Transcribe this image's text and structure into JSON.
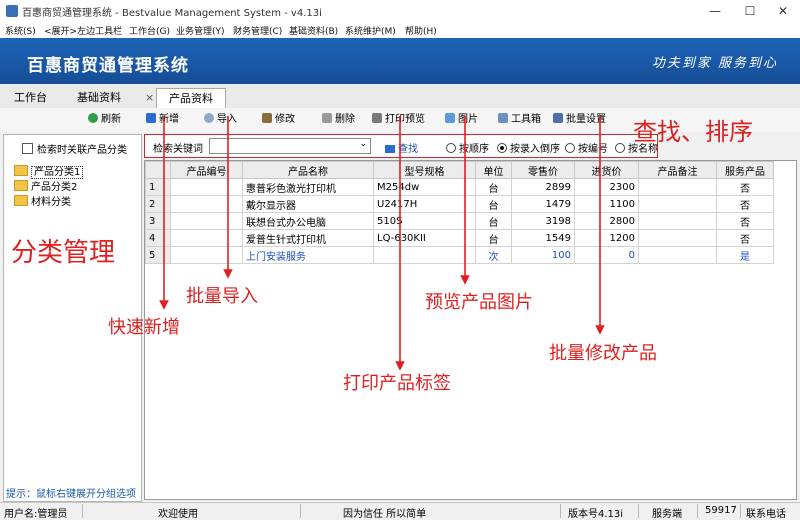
{
  "window": {
    "title": "百惠商贸通管理系统 - Bestvalue Management System - v4.13i",
    "minimize": "—",
    "maximize": "☐",
    "close": "✕"
  },
  "menu": [
    "系统(S)",
    "<展开>左边工具栏",
    "工作台(G)",
    "业务管理(Y)",
    "财务管理(C)",
    "基础资料(B)",
    "系统维护(M)",
    "帮助(H)"
  ],
  "banner": {
    "title": "百惠商贸通管理系统",
    "slogan": "功夫到家  服务到心"
  },
  "tabs": [
    {
      "label": "工作台"
    },
    {
      "label": "基础资料"
    },
    {
      "label": "产品资料",
      "close": "×"
    }
  ],
  "toolbar": {
    "refresh": "刷新",
    "add": "新增",
    "import": "导入",
    "modify": "修改",
    "delete": "删除",
    "print_preview": "打印预览",
    "image": "图片",
    "toolbox": "工具箱",
    "batch_settings": "批量设置"
  },
  "left_panel": {
    "checkbox_label": "检索时关联产品分类",
    "tree": [
      "产品分类1",
      "产品分类2",
      "材料分类"
    ],
    "hint": "提示：鼠标右键展开分组选项"
  },
  "search": {
    "keyword_label": "检索关键词",
    "value": "",
    "find_button": "查找",
    "sort_options": [
      {
        "label": "按顺序",
        "selected": false
      },
      {
        "label": "按录入倒序",
        "selected": true
      },
      {
        "label": "按编号",
        "selected": false
      },
      {
        "label": "按名称",
        "selected": false
      }
    ]
  },
  "table": {
    "columns": [
      "",
      "产品编号",
      "产品名称",
      "型号规格",
      "单位",
      "零售价",
      "进货价",
      "产品备注",
      "服务产品"
    ],
    "rows": [
      [
        "1",
        "",
        "惠普彩色激光打印机",
        "M254dw",
        "台",
        "2899",
        "2300",
        "",
        "否"
      ],
      [
        "2",
        "",
        "戴尔显示器",
        "U2417H",
        "台",
        "1479",
        "1100",
        "",
        "否"
      ],
      [
        "3",
        "",
        "联想台式办公电脑",
        "510S",
        "台",
        "3198",
        "2800",
        "",
        "否"
      ],
      [
        "4",
        "",
        "爱普生针式打印机",
        "LQ-630KII",
        "台",
        "1549",
        "1200",
        "",
        "否"
      ],
      [
        "5",
        "",
        "上门安装服务",
        "",
        "次",
        "100",
        "0",
        "",
        "是"
      ]
    ]
  },
  "status_bar": {
    "user": "用户名:管理员",
    "welcome": "欢迎使用",
    "motto": "因为信任 所以简单",
    "version": "版本号4.13i",
    "server": "服务端",
    "count": "59917",
    "contact": "联系电话"
  },
  "annotations": {
    "search_sort": "查找、排序",
    "category": "分类管理",
    "batch_import": "批量导入",
    "quick_add": "快速新增",
    "preview_image": "预览产品图片",
    "print_label": "打印产品标签",
    "batch_modify": "批量修改产品"
  },
  "colors": {
    "banner": "#1a58a6",
    "annotation": "#e02020",
    "service_row": "#1a4fc8"
  }
}
